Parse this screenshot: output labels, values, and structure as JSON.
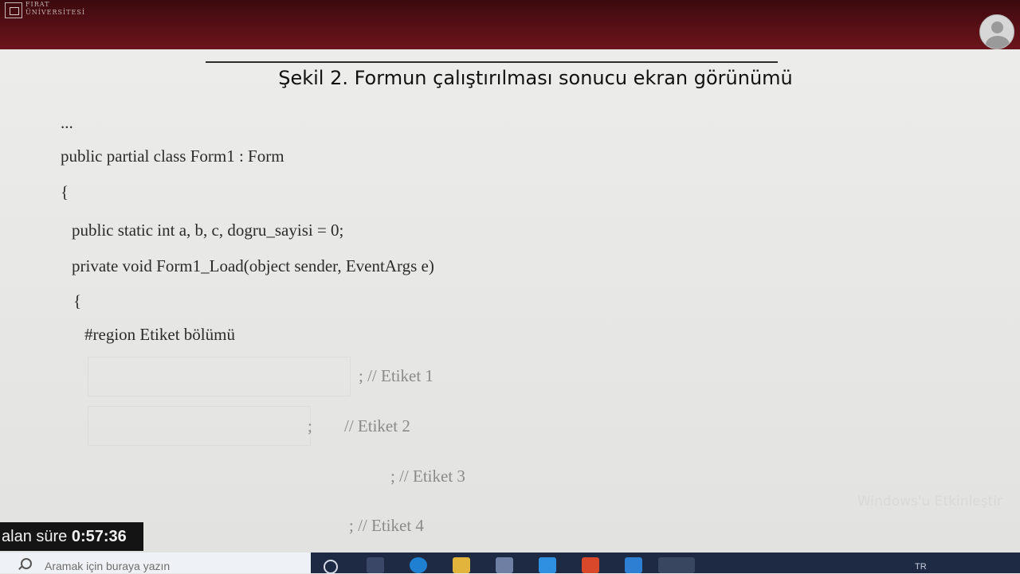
{
  "header": {
    "university_name_line1": "FIRAT",
    "university_name_line2": "ÜNİVERSİTESİ"
  },
  "slide": {
    "caption": "Şekil 2. Formun çalıştırılması sonucu ekran görünümü",
    "code_lines": [
      "...",
      "public partial class Form1 : Form",
      "{",
      "public static int a, b, c, dogru_sayisi = 0;",
      "private void Form1_Load(object sender, EventArgs e)",
      "{",
      "#region Etiket bölümü"
    ],
    "blank_lines": [
      "; // Etiket 1",
      ";",
      "// Etiket 2",
      "; // Etiket 3",
      "; // Etiket 4"
    ],
    "watermark": "Windows'u Etkinleştir"
  },
  "timer": {
    "label": "alan süre",
    "value": "0:57:36"
  },
  "taskbar": {
    "search_placeholder": "Aramak için buraya yazın",
    "language": "TR",
    "icons": [
      "task-view-icon",
      "edge-icon",
      "file-explorer-icon",
      "store-icon",
      "mail-icon",
      "office-icon",
      "app-icon",
      "chrome-icon"
    ]
  }
}
